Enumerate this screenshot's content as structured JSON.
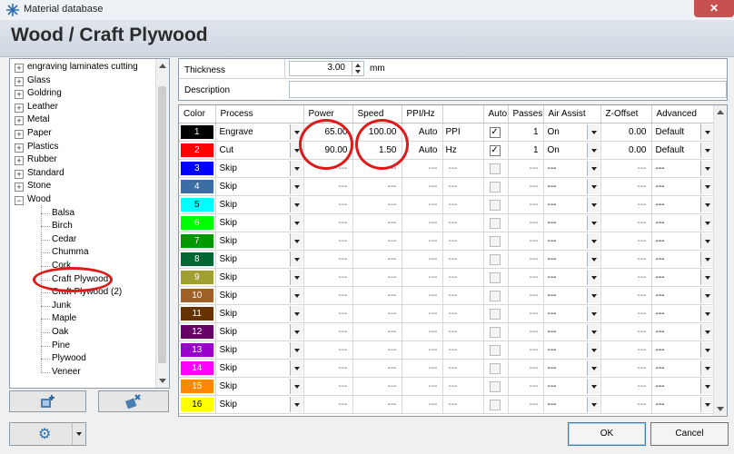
{
  "window": {
    "title": "Material database",
    "close_symbol": "✕"
  },
  "header": {
    "title": "Wood / Craft Plywood"
  },
  "tree": {
    "top_items": [
      {
        "label": "engraving laminates cutting"
      },
      {
        "label": "Glass"
      },
      {
        "label": "Goldring"
      },
      {
        "label": "Leather"
      },
      {
        "label": "Metal"
      },
      {
        "label": "Paper"
      },
      {
        "label": "Plastics"
      },
      {
        "label": "Rubber"
      },
      {
        "label": "Standard"
      },
      {
        "label": "Stone"
      },
      {
        "label": "Wood"
      }
    ],
    "expanded_symbol": "−",
    "collapsed_symbol": "+",
    "wood_children": [
      {
        "label": "Balsa"
      },
      {
        "label": "Birch"
      },
      {
        "label": "Cedar"
      },
      {
        "label": "Chumma"
      },
      {
        "label": "Cork"
      },
      {
        "label": "Craft Plywood"
      },
      {
        "label": "Craft Plywood (2)"
      },
      {
        "label": "Junk"
      },
      {
        "label": "Maple"
      },
      {
        "label": "Oak"
      },
      {
        "label": "Pine"
      },
      {
        "label": "Plywood"
      },
      {
        "label": "Veneer"
      }
    ],
    "selected": "Craft Plywood"
  },
  "properties": {
    "thickness_label": "Thickness",
    "thickness_value": "3.00",
    "thickness_unit": "mm",
    "description_label": "Description",
    "description_value": ""
  },
  "grid": {
    "columns": [
      "Color",
      "Process",
      "Power",
      "Speed",
      "PPI/Hz",
      "",
      "Auto",
      "Passes",
      "Air Assist",
      "Z-Offset",
      "Advanced"
    ],
    "dash": "---",
    "check_mark": "✓",
    "rows": [
      {
        "num": "1",
        "color": "#000000",
        "text_color": "#ffffff",
        "process": "Engrave",
        "power": "65.00",
        "speed": "100.00",
        "ppi": "Auto",
        "unit": "PPI",
        "auto": true,
        "passes": "1",
        "air": "On",
        "z": "0.00",
        "adv": "Default",
        "active": true
      },
      {
        "num": "2",
        "color": "#ff0000",
        "text_color": "#ffffff",
        "process": "Cut",
        "power": "90.00",
        "speed": "1.50",
        "ppi": "Auto",
        "unit": "Hz",
        "auto": true,
        "passes": "1",
        "air": "On",
        "z": "0.00",
        "adv": "Default",
        "active": true
      },
      {
        "num": "3",
        "color": "#0000ff",
        "text_color": "#ffffff",
        "process": "Skip",
        "active": false
      },
      {
        "num": "4",
        "color": "#3a6ea5",
        "text_color": "#ffffff",
        "process": "Skip",
        "active": false
      },
      {
        "num": "5",
        "color": "#00ffff",
        "text_color": "#000000",
        "process": "Skip",
        "active": false
      },
      {
        "num": "6",
        "color": "#00ff00",
        "text_color": "#ffffff",
        "process": "Skip",
        "active": false
      },
      {
        "num": "7",
        "color": "#009900",
        "text_color": "#ffffff",
        "process": "Skip",
        "active": false
      },
      {
        "num": "8",
        "color": "#006633",
        "text_color": "#ffffff",
        "process": "Skip",
        "active": false
      },
      {
        "num": "9",
        "color": "#a0a030",
        "text_color": "#ffffff",
        "process": "Skip",
        "active": false
      },
      {
        "num": "10",
        "color": "#a0602a",
        "text_color": "#ffffff",
        "process": "Skip",
        "active": false
      },
      {
        "num": "11",
        "color": "#663300",
        "text_color": "#ffffff",
        "process": "Skip",
        "active": false
      },
      {
        "num": "12",
        "color": "#660066",
        "text_color": "#ffffff",
        "process": "Skip",
        "active": false
      },
      {
        "num": "13",
        "color": "#9900cc",
        "text_color": "#ffffff",
        "process": "Skip",
        "active": false
      },
      {
        "num": "14",
        "color": "#ff00ff",
        "text_color": "#ffffff",
        "process": "Skip",
        "active": false
      },
      {
        "num": "15",
        "color": "#ff8800",
        "text_color": "#ffffff",
        "process": "Skip",
        "active": false
      },
      {
        "num": "16",
        "color": "#ffff00",
        "text_color": "#000000",
        "process": "Skip",
        "active": false
      }
    ]
  },
  "buttons": {
    "ok": "OK",
    "cancel": "Cancel",
    "gear_symbol": "⚙"
  },
  "icons": {
    "app": "laser-app-icon",
    "add_material": "add-material-icon",
    "delete_material": "delete-material-icon",
    "settings": "gear-icon"
  },
  "annotation_color": "#e01818"
}
